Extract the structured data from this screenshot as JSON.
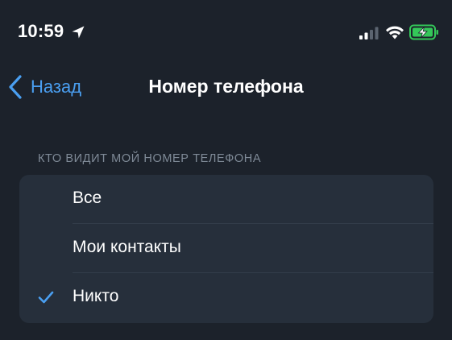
{
  "status_bar": {
    "time": "10:59",
    "icons": [
      "location-arrow-icon",
      "cellular-signal-icon",
      "wifi-icon",
      "battery-charging-icon"
    ],
    "battery_color": "#34c759"
  },
  "nav": {
    "back_label": "Назад",
    "title": "Номер телефона",
    "accent_color": "#4a9ff1"
  },
  "section": {
    "header": "КТО ВИДИТ МОЙ НОМЕР ТЕЛЕФОНА",
    "options": [
      {
        "label": "Все",
        "selected": false
      },
      {
        "label": "Мои контакты",
        "selected": false
      },
      {
        "label": "Никто",
        "selected": true
      }
    ]
  }
}
